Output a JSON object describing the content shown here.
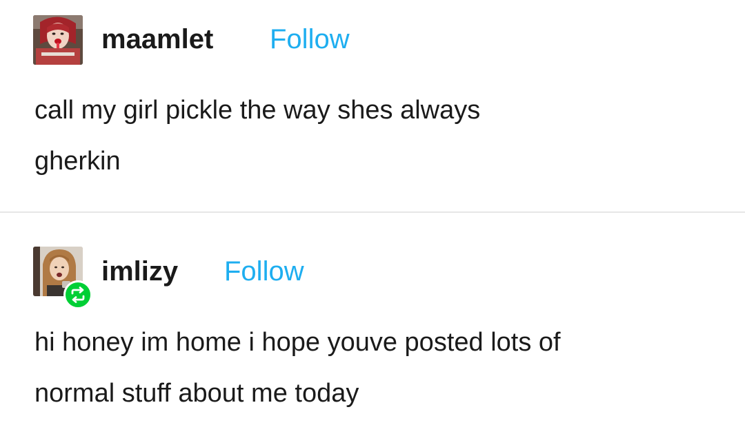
{
  "posts": [
    {
      "username": "maamlet",
      "follow_label": "Follow",
      "avatar_icon": "user-avatar-photo",
      "text_lines": [
        "call my girl pickle the way shes always",
        "gherkin"
      ]
    },
    {
      "username": "imlizy",
      "follow_label": "Follow",
      "avatar_icon": "user-avatar-photo",
      "badge_icon": "reblog-icon",
      "text_lines": [
        "hi honey im home i hope youve posted lots of",
        "normal stuff about me today"
      ]
    }
  ],
  "colors": {
    "follow": "#1eaef0",
    "reblog_badge": "#00cf35",
    "text": "#1a1a1a",
    "divider": "#e6e6e6"
  }
}
